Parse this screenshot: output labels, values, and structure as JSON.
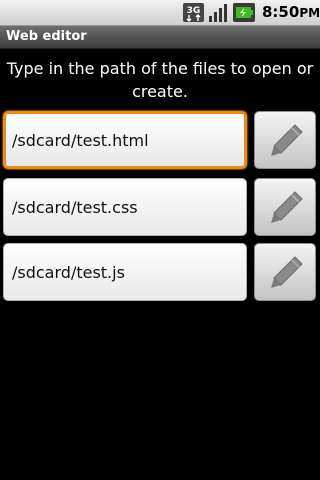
{
  "status_bar": {
    "time": "8:50",
    "ampm": "PM",
    "network_label": "3G",
    "icons": [
      "3g-network-icon",
      "signal-strength-icon",
      "battery-charging-icon"
    ]
  },
  "title_bar": {
    "title": "Web editor"
  },
  "instructions": "Type in the path of the files to open or create.",
  "files": [
    {
      "path": "/sdcard/test.html",
      "focused": true
    },
    {
      "path": "/sdcard/test.css",
      "focused": false
    },
    {
      "path": "/sdcard/test.js",
      "focused": false
    }
  ],
  "colors": {
    "background": "#000000",
    "focus_accent": "#f08a12",
    "battery_green": "#3fbf1f"
  },
  "edit_button_icon": "pencil-icon"
}
